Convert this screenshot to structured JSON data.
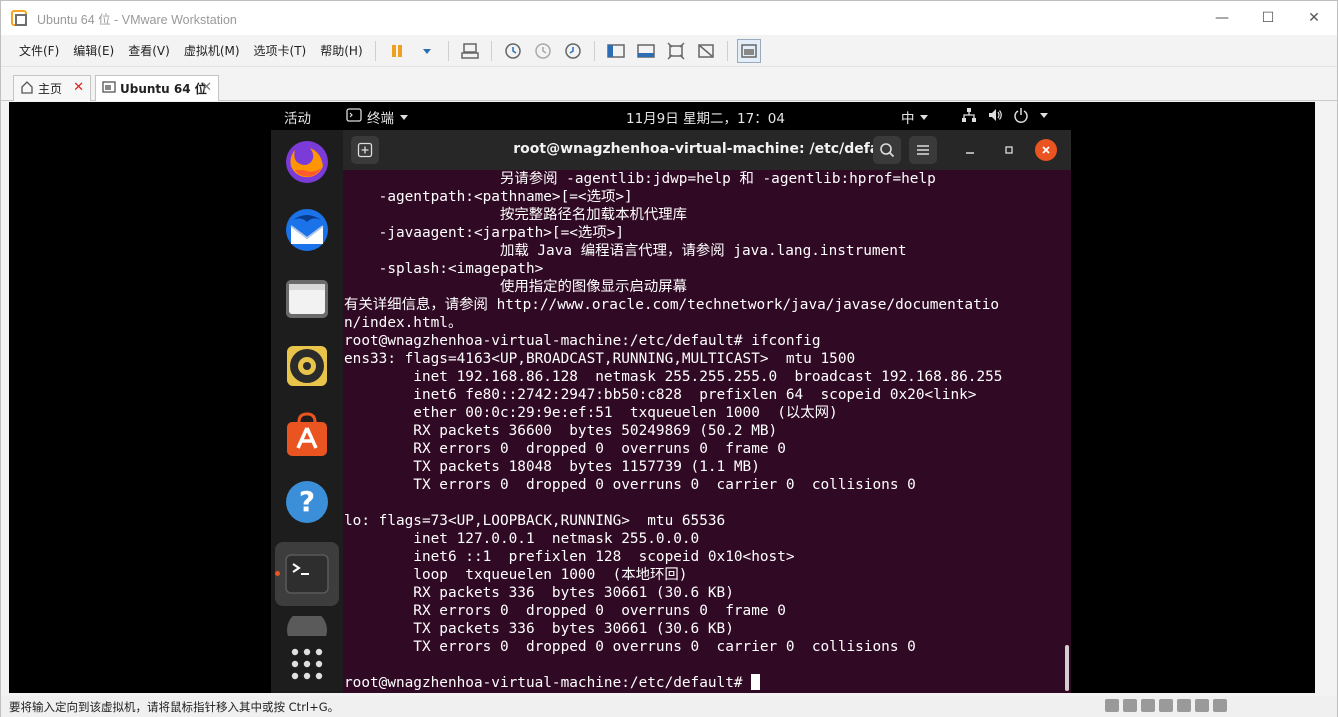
{
  "window": {
    "title": "Ubuntu 64 位 - VMware Workstation",
    "controls": [
      "—",
      "☐",
      "✕"
    ]
  },
  "menu": {
    "items": [
      "文件(F)",
      "编辑(E)",
      "查看(V)",
      "虚拟机(M)",
      "选项卡(T)",
      "帮助(H)"
    ]
  },
  "toolbar": {
    "icons": [
      "pause-icon",
      "dropdown-icon",
      "send-keys-icon",
      "snapshot-icon",
      "revert-snapshot-icon",
      "snapshot-manager-icon",
      "library-icon",
      "console-view-icon",
      "fullscreen-icon",
      "unity-icon",
      "thumbnail-icon"
    ]
  },
  "tabs": [
    {
      "label": "主页",
      "close": "✕"
    },
    {
      "label": "Ubuntu 64 位",
      "close": "✕"
    }
  ],
  "ubuntu": {
    "topbar": {
      "activities": "活动",
      "app_name": "终端",
      "clock": "11月9日 星期二，17：04",
      "ime": "中"
    },
    "dock": [
      "firefox-icon",
      "thunderbird-icon",
      "files-icon",
      "rhythmbox-icon",
      "software-icon",
      "help-icon",
      "terminal-icon",
      "more-icon",
      "app-grid-icon"
    ]
  },
  "terminal": {
    "title": "root@wnagzhenhoa-virtual-machine: /etc/default",
    "lines": [
      "                  另请参阅 -agentlib:jdwp=help 和 -agentlib:hprof=help",
      "    -agentpath:<pathname>[=<选项>]",
      "                  按完整路径名加载本机代理库",
      "    -javaagent:<jarpath>[=<选项>]",
      "                  加载 Java 编程语言代理，请参阅 java.lang.instrument",
      "    -splash:<imagepath>",
      "                  使用指定的图像显示启动屏幕",
      "有关详细信息，请参阅 http://www.oracle.com/technetwork/java/javase/documentatio",
      "n/index.html。",
      "root@wnagzhenhoa-virtual-machine:/etc/default# ifconfig",
      "ens33: flags=4163<UP,BROADCAST,RUNNING,MULTICAST>  mtu 1500",
      "        inet 192.168.86.128  netmask 255.255.255.0  broadcast 192.168.86.255",
      "        inet6 fe80::2742:2947:bb50:c828  prefixlen 64  scopeid 0x20<link>",
      "        ether 00:0c:29:9e:ef:51  txqueuelen 1000  (以太网)",
      "        RX packets 36600  bytes 50249869 (50.2 MB)",
      "        RX errors 0  dropped 0  overruns 0  frame 0",
      "        TX packets 18048  bytes 1157739 (1.1 MB)",
      "        TX errors 0  dropped 0 overruns 0  carrier 0  collisions 0",
      "",
      "lo: flags=73<UP,LOOPBACK,RUNNING>  mtu 65536",
      "        inet 127.0.0.1  netmask 255.0.0.0",
      "        inet6 ::1  prefixlen 128  scopeid 0x10<host>",
      "        loop  txqueuelen 1000  (本地环回)",
      "        RX packets 336  bytes 30661 (30.6 KB)",
      "        RX errors 0  dropped 0  overruns 0  frame 0",
      "        TX packets 336  bytes 30661 (30.6 KB)",
      "        TX errors 0  dropped 0 overruns 0  carrier 0  collisions 0",
      ""
    ],
    "prompt": "root@wnagzhenhoa-virtual-machine:/etc/default# "
  },
  "status": {
    "message": "要将输入定向到该虚拟机，请将鼠标指针移入其中或按 Ctrl+G。"
  },
  "colors": {
    "terminal_bg": "#300a24",
    "ubuntu_orange": "#e95420"
  }
}
